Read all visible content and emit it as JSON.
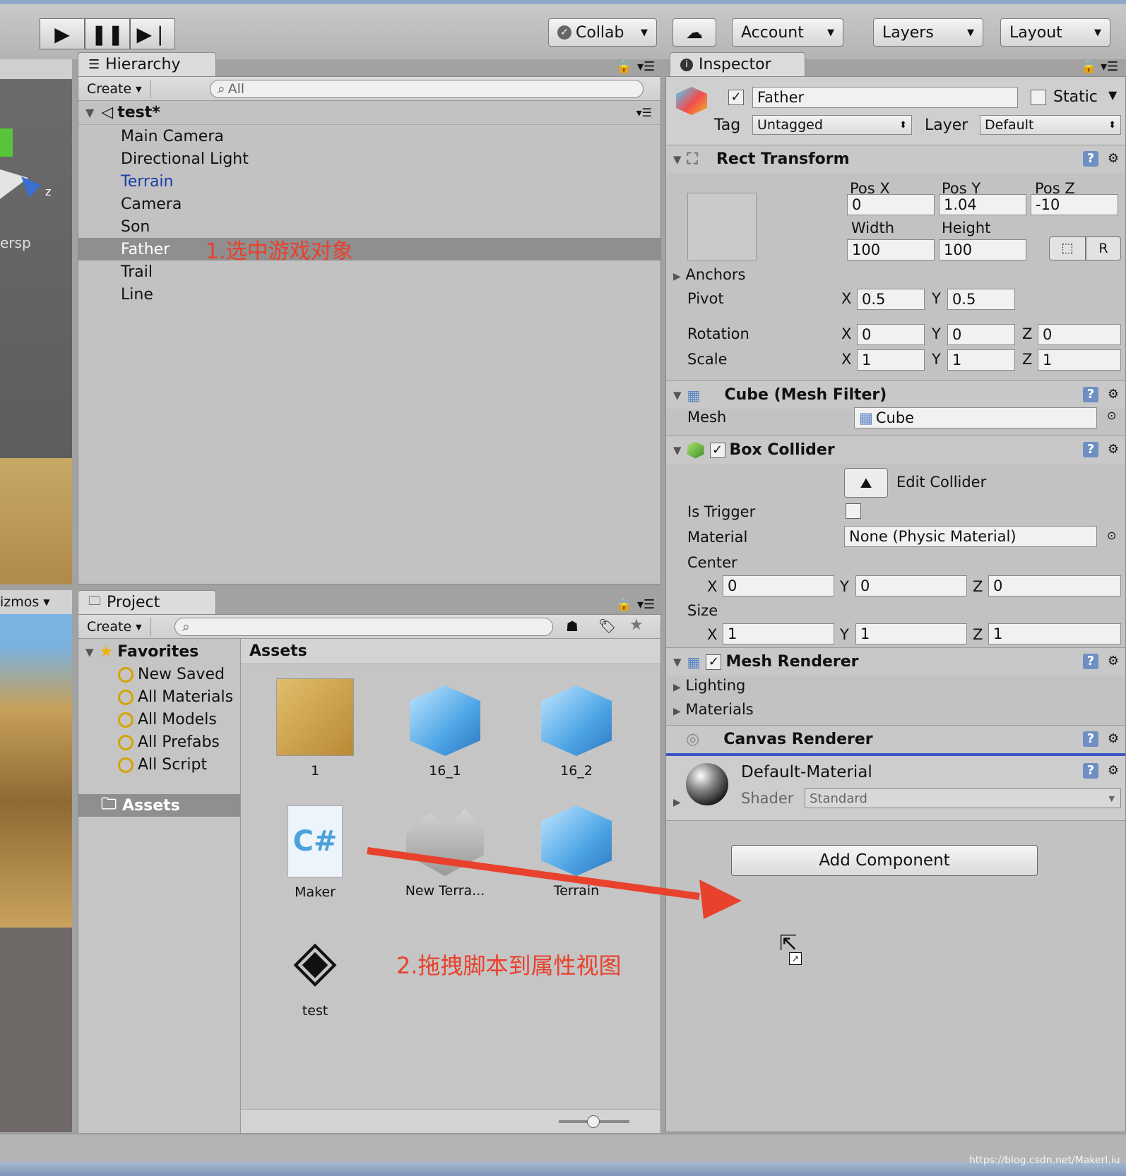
{
  "toolbar": {
    "collab": "Collab",
    "account": "Account",
    "layers": "Layers",
    "layout": "Layout"
  },
  "scene": {
    "z_label": "z",
    "persp": "ersp",
    "gizmos": "izmos"
  },
  "hierarchy": {
    "tab": "Hierarchy",
    "create": "Create",
    "search_placeholder": "All",
    "scene_name": "test*",
    "items": [
      "Main Camera",
      "Directional Light",
      "Terrain",
      "Camera",
      "Son",
      "Father",
      "Trail",
      "Line"
    ],
    "annotation": "1.选中游戏对象"
  },
  "project": {
    "tab": "Project",
    "create": "Create",
    "favorites_label": "Favorites",
    "favorites": [
      "New Saved",
      "All Materials",
      "All Models",
      "All Prefabs",
      "All Script"
    ],
    "assets_folder": "Assets",
    "assets_header": "Assets",
    "assets": [
      "1",
      "16_1",
      "16_2",
      "Maker",
      "New Terra...",
      "Terrain",
      "test"
    ],
    "annotation": "2.拖拽脚本到属性视图"
  },
  "inspector": {
    "tab": "Inspector",
    "object_name": "Father",
    "static_label": "Static",
    "tag_label": "Tag",
    "tag_value": "Untagged",
    "layer_label": "Layer",
    "layer_value": "Default",
    "rect_transform": {
      "title": "Rect Transform",
      "pos_x_label": "Pos X",
      "pos_y_label": "Pos Y",
      "pos_z_label": "Pos Z",
      "pos_x": "0",
      "pos_y": "1.04",
      "pos_z": "-10",
      "width_label": "Width",
      "height_label": "Height",
      "width": "100",
      "height": "100",
      "r_button": "R",
      "anchors": "Anchors",
      "pivot": "Pivot",
      "pivot_x": "0.5",
      "pivot_y": "0.5",
      "rotation": "Rotation",
      "rot_x": "0",
      "rot_y": "0",
      "rot_z": "0",
      "scale": "Scale",
      "scale_x": "1",
      "scale_y": "1",
      "scale_z": "1"
    },
    "mesh_filter": {
      "title": "Cube (Mesh Filter)",
      "mesh_label": "Mesh",
      "mesh_value": "Cube"
    },
    "box_collider": {
      "title": "Box Collider",
      "edit_collider": "Edit Collider",
      "is_trigger": "Is Trigger",
      "material_label": "Material",
      "material_value": "None (Physic Material)",
      "center": "Center",
      "cx": "0",
      "cy": "0",
      "cz": "0",
      "size": "Size",
      "sx": "1",
      "sy": "1",
      "sz": "1"
    },
    "mesh_renderer": {
      "title": "Mesh Renderer",
      "lighting": "Lighting",
      "materials": "Materials"
    },
    "canvas_renderer": {
      "title": "Canvas Renderer"
    },
    "material": {
      "name": "Default-Material",
      "shader_label": "Shader",
      "shader_value": "Standard"
    },
    "add_component": "Add Component"
  },
  "axes": {
    "x": "X",
    "y": "Y",
    "z": "Z"
  },
  "watermark": "https://blog.csdn.net/Makerl.iu",
  "colors": {
    "annotation": "#e8412c",
    "selected_row": "#8f8f8f",
    "terrain_link": "#1a3fa8"
  }
}
